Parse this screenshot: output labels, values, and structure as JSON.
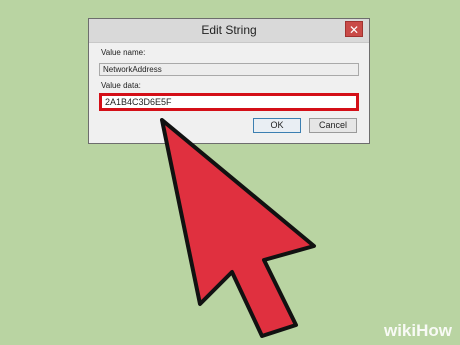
{
  "dialog": {
    "title": "Edit String",
    "close_glyph": "✕",
    "value_name_label": "Value name:",
    "value_name": "NetworkAddress",
    "value_data_label": "Value data:",
    "value_data": "2A1B4C3D6E5F",
    "ok_label": "OK",
    "cancel_label": "Cancel"
  },
  "overlay": {
    "arrow_color": "#e0303f",
    "highlight_color": "#d40f18",
    "watermark": "wikiHow"
  }
}
